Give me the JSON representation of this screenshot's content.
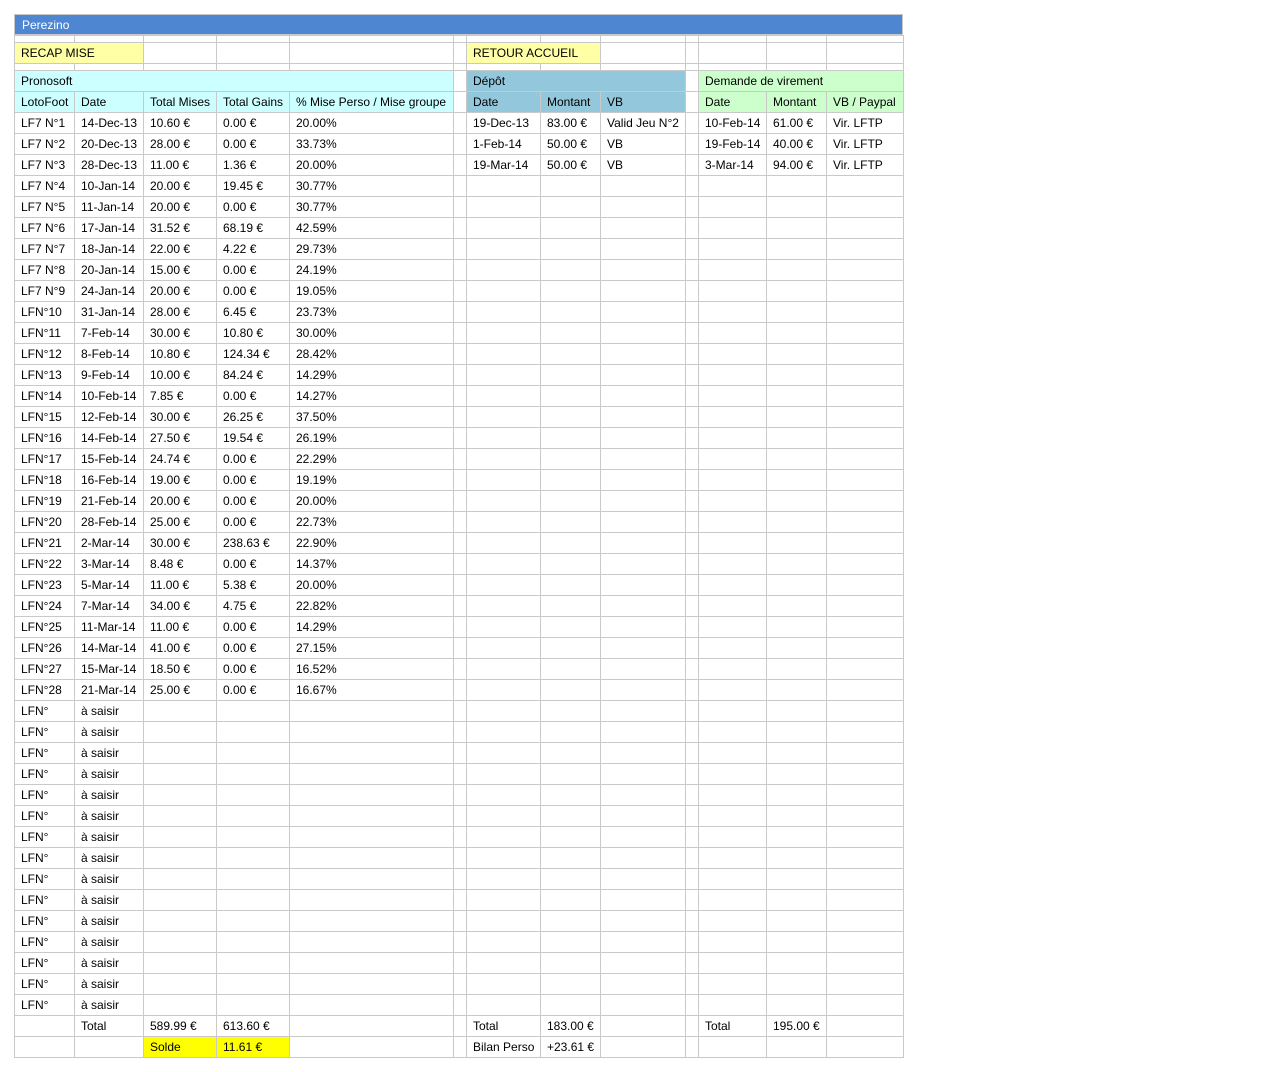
{
  "sheet_title": "Perezino",
  "buttons": {
    "recap_mise": "RECAP MISE",
    "retour_accueil": "RETOUR ACCUEIL"
  },
  "pronosoft": {
    "title": "Pronosoft",
    "headers": [
      "LotoFoot",
      "Date",
      "Total Mises",
      "Total Gains",
      "% Mise Perso / Mise groupe"
    ],
    "rows": [
      [
        "LF7 N°1",
        "14-Dec-13",
        "10.60 €",
        "0.00 €",
        "20.00%"
      ],
      [
        "LF7 N°2",
        "20-Dec-13",
        "28.00 €",
        "0.00 €",
        "33.73%"
      ],
      [
        "LF7 N°3",
        "28-Dec-13",
        "11.00 €",
        "1.36 €",
        "20.00%"
      ],
      [
        "LF7 N°4",
        "10-Jan-14",
        "20.00 €",
        "19.45 €",
        "30.77%"
      ],
      [
        "LF7 N°5",
        "11-Jan-14",
        "20.00 €",
        "0.00 €",
        "30.77%"
      ],
      [
        "LF7 N°6",
        "17-Jan-14",
        "31.52 €",
        "68.19 €",
        "42.59%"
      ],
      [
        "LF7 N°7",
        "18-Jan-14",
        "22.00 €",
        "4.22 €",
        "29.73%"
      ],
      [
        "LF7 N°8",
        "20-Jan-14",
        "15.00 €",
        "0.00 €",
        "24.19%"
      ],
      [
        "LF7 N°9",
        "24-Jan-14",
        "20.00 €",
        "0.00 €",
        "19.05%"
      ],
      [
        "LFN°10",
        "31-Jan-14",
        "28.00 €",
        "6.45 €",
        "23.73%"
      ],
      [
        "LFN°11",
        "7-Feb-14",
        "30.00 €",
        "10.80 €",
        "30.00%"
      ],
      [
        "LFN°12",
        "8-Feb-14",
        "10.80 €",
        "124.34 €",
        "28.42%"
      ],
      [
        "LFN°13",
        "9-Feb-14",
        "10.00 €",
        "84.24 €",
        "14.29%"
      ],
      [
        "LFN°14",
        "10-Feb-14",
        "7.85 €",
        "0.00 €",
        "14.27%"
      ],
      [
        "LFN°15",
        "12-Feb-14",
        "30.00 €",
        "26.25 €",
        "37.50%"
      ],
      [
        "LFN°16",
        "14-Feb-14",
        "27.50 €",
        "19.54 €",
        "26.19%"
      ],
      [
        "LFN°17",
        "15-Feb-14",
        "24.74 €",
        "0.00 €",
        "22.29%"
      ],
      [
        "LFN°18",
        "16-Feb-14",
        "19.00 €",
        "0.00 €",
        "19.19%"
      ],
      [
        "LFN°19",
        "21-Feb-14",
        "20.00 €",
        "0.00 €",
        "20.00%"
      ],
      [
        "LFN°20",
        "28-Feb-14",
        "25.00 €",
        "0.00 €",
        "22.73%"
      ],
      [
        "LFN°21",
        "2-Mar-14",
        "30.00 €",
        "238.63 €",
        "22.90%"
      ],
      [
        "LFN°22",
        "3-Mar-14",
        "8.48 €",
        "0.00 €",
        "14.37%"
      ],
      [
        "LFN°23",
        "5-Mar-14",
        "11.00 €",
        "5.38 €",
        "20.00%"
      ],
      [
        "LFN°24",
        "7-Mar-14",
        "34.00 €",
        "4.75 €",
        "22.82%"
      ],
      [
        "LFN°25",
        "11-Mar-14",
        "11.00 €",
        "0.00 €",
        "14.29%"
      ],
      [
        "LFN°26",
        "14-Mar-14",
        "41.00 €",
        "0.00 €",
        "27.15%"
      ],
      [
        "LFN°27",
        "15-Mar-14",
        "18.50 €",
        "0.00 €",
        "16.52%"
      ],
      [
        "LFN°28",
        "21-Mar-14",
        "25.00 €",
        "0.00 €",
        "16.67%"
      ],
      [
        "LFN°",
        "à saisir",
        "",
        "",
        ""
      ],
      [
        "LFN°",
        "à saisir",
        "",
        "",
        ""
      ],
      [
        "LFN°",
        "à saisir",
        "",
        "",
        ""
      ],
      [
        "LFN°",
        "à saisir",
        "",
        "",
        ""
      ],
      [
        "LFN°",
        "à saisir",
        "",
        "",
        ""
      ],
      [
        "LFN°",
        "à saisir",
        "",
        "",
        ""
      ],
      [
        "LFN°",
        "à saisir",
        "",
        "",
        ""
      ],
      [
        "LFN°",
        "à saisir",
        "",
        "",
        ""
      ],
      [
        "LFN°",
        "à saisir",
        "",
        "",
        ""
      ],
      [
        "LFN°",
        "à saisir",
        "",
        "",
        ""
      ],
      [
        "LFN°",
        "à saisir",
        "",
        "",
        ""
      ],
      [
        "LFN°",
        "à saisir",
        "",
        "",
        ""
      ],
      [
        "LFN°",
        "à saisir",
        "",
        "",
        ""
      ],
      [
        "LFN°",
        "à saisir",
        "",
        "",
        ""
      ],
      [
        "LFN°",
        "à saisir",
        "",
        "",
        ""
      ]
    ],
    "total_label": "Total",
    "total_mises": "589.99 €",
    "total_gains": "613.60 €",
    "solde_label": "Solde",
    "solde_value": "11.61 €"
  },
  "depot": {
    "title": "Dépôt",
    "headers": [
      "Date",
      "Montant",
      "VB"
    ],
    "rows": [
      [
        "19-Dec-13",
        "83.00 €",
        "Valid Jeu N°2"
      ],
      [
        "1-Feb-14",
        "50.00 €",
        "VB"
      ],
      [
        "19-Mar-14",
        "50.00 €",
        "VB"
      ]
    ],
    "total_label": "Total",
    "total_value": "183.00 €",
    "bilan_label": "Bilan Perso",
    "bilan_value": "+23.61 €"
  },
  "virement": {
    "title": "Demande de virement",
    "headers": [
      "Date",
      "Montant",
      "VB / Paypal"
    ],
    "rows": [
      [
        "10-Feb-14",
        "61.00 €",
        "Vir. LFTP"
      ],
      [
        "19-Feb-14",
        "40.00 €",
        "Vir. LFTP"
      ],
      [
        "3-Mar-14",
        "94.00 €",
        "Vir. LFTP"
      ]
    ],
    "total_label": "Total",
    "total_value": "195.00 €"
  }
}
